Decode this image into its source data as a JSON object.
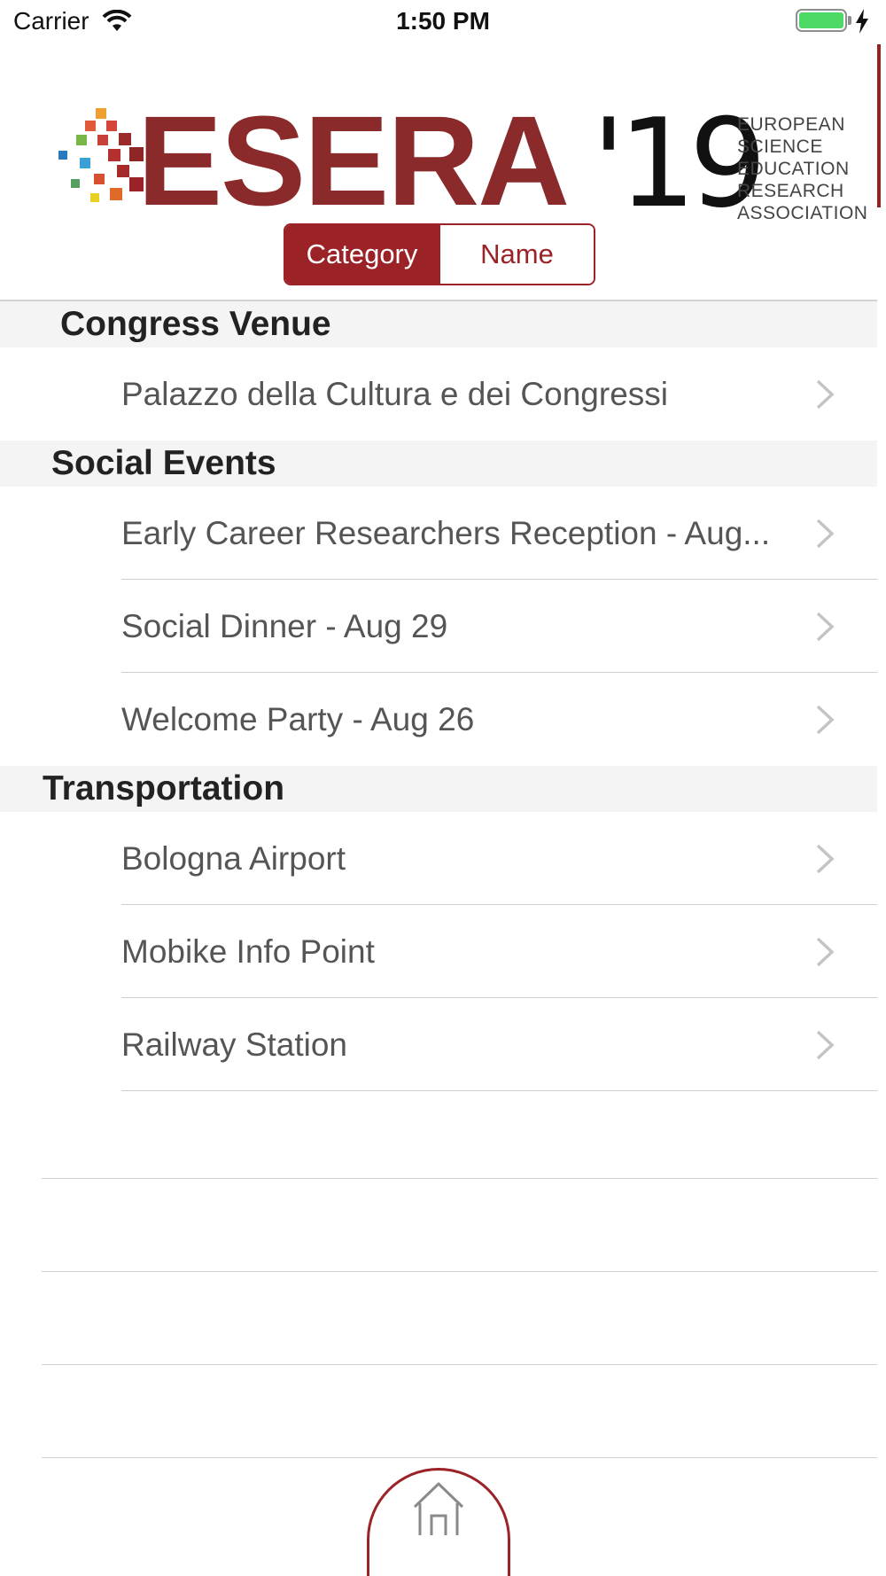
{
  "status_bar": {
    "carrier": "Carrier",
    "time": "1:50 PM",
    "wifi_icon": "wifi-icon",
    "battery_icon": "battery-icon",
    "charging_icon": "lightning-bolt-icon",
    "battery_level": 1.0,
    "battery_color": "#4cd964"
  },
  "header": {
    "logo_text": "ESERA",
    "logo_year": "'19",
    "logo_subtitle_lines": [
      "EUROPEAN",
      "SCIENCE",
      "EDUCATION",
      "RESEARCH",
      "ASSOCIATION"
    ],
    "brand_color": "#9b2226"
  },
  "segmented_control": {
    "options": [
      "Category",
      "Name"
    ],
    "selected": "Category"
  },
  "sections": [
    {
      "title": "Congress Venue",
      "items": [
        "Palazzo della Cultura e dei Congressi"
      ]
    },
    {
      "title": "Social Events",
      "items": [
        "Early Career Researchers Reception - Aug...",
        "Social Dinner - Aug 29",
        "Welcome Party - Aug 26"
      ]
    },
    {
      "title": "Transportation",
      "items": [
        "Bologna Airport",
        "Mobike Info Point",
        "Railway Station"
      ]
    }
  ],
  "bottom_bar": {
    "home_icon": "home-icon"
  }
}
